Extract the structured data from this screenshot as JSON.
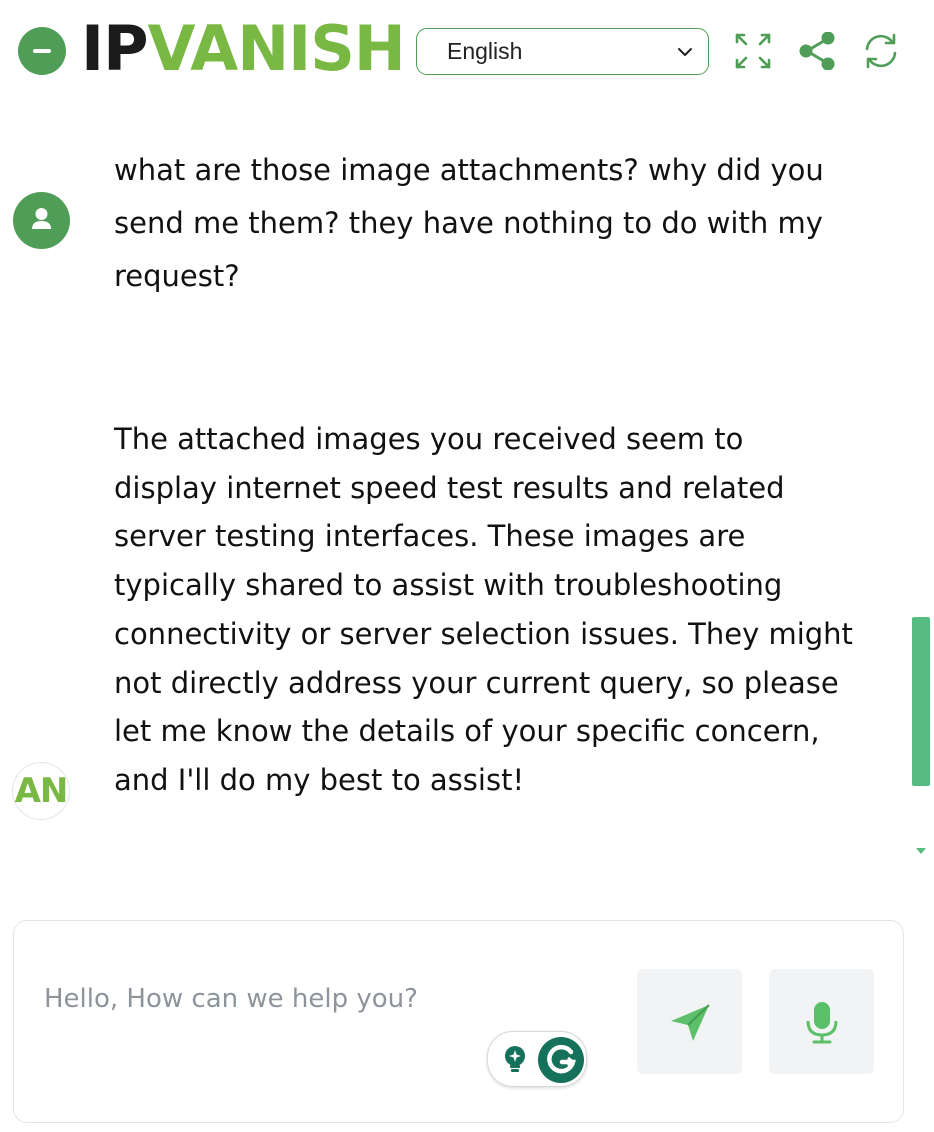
{
  "header": {
    "logo_ip": "IP",
    "logo_vanish": "VANISH",
    "language": "English",
    "icons": [
      "minimize-icon",
      "expand-icon",
      "share-icon",
      "refresh-icon"
    ]
  },
  "chat": {
    "messages": [
      {
        "role": "user",
        "text": "what are those image attachments? why did you send me them? they have nothing to do with my request?"
      },
      {
        "role": "assistant",
        "text": "The attached images you received seem to display internet speed test results and related server testing interfaces. These images are typically shared to assist with troubleshooting connectivity or server selection issues. They might not directly address your current query, so please let me know the details of your specific concern, and I'll do my best to assist!"
      }
    ],
    "bot_avatar_text": "AN"
  },
  "composer": {
    "placeholder": "Hello, How can we help you?",
    "value": ""
  },
  "colors": {
    "brand_green": "#4f9d57",
    "logo_green": "#7ab844",
    "scrollbar": "#57bc82",
    "grammarly": "#15715a"
  }
}
